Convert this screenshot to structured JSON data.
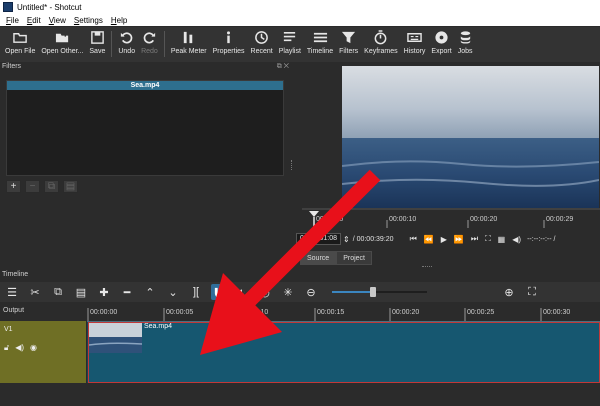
{
  "window": {
    "title": "Untitled* - Shotcut"
  },
  "menu": [
    "File",
    "Edit",
    "View",
    "Settings",
    "Help"
  ],
  "toolbar": [
    {
      "label": "Open File",
      "icon": "open-file-icon",
      "enabled": true
    },
    {
      "label": "Open Other...",
      "icon": "open-other-icon",
      "enabled": true
    },
    {
      "label": "Save",
      "icon": "save-icon",
      "enabled": true
    },
    {
      "label": "Undo",
      "icon": "undo-icon",
      "enabled": true
    },
    {
      "label": "Redo",
      "icon": "redo-icon",
      "enabled": false
    },
    {
      "label": "Peak Meter",
      "icon": "peak-meter-icon",
      "enabled": true
    },
    {
      "label": "Properties",
      "icon": "properties-icon",
      "enabled": true
    },
    {
      "label": "Recent",
      "icon": "recent-icon",
      "enabled": true
    },
    {
      "label": "Playlist",
      "icon": "playlist-icon",
      "enabled": true
    },
    {
      "label": "Timeline",
      "icon": "timeline-icon",
      "enabled": true
    },
    {
      "label": "Filters",
      "icon": "filters-icon",
      "enabled": true
    },
    {
      "label": "Keyframes",
      "icon": "keyframes-icon",
      "enabled": true
    },
    {
      "label": "History",
      "icon": "history-icon",
      "enabled": true
    },
    {
      "label": "Export",
      "icon": "export-icon",
      "enabled": true
    },
    {
      "label": "Jobs",
      "icon": "jobs-icon",
      "enabled": true
    }
  ],
  "filters": {
    "header": "Filters",
    "selected_clip": "Sea.mp4"
  },
  "player": {
    "ruler_ticks": [
      "00:00:00",
      "00:00:10",
      "00:00:20",
      "00:00:29"
    ],
    "current_time": "00:00:01:08",
    "duration": "/ 00:00:39:20",
    "in_out": "--:--:--:-- /",
    "tabs": [
      "Source",
      "Project"
    ]
  },
  "timeline": {
    "header": "Timeline",
    "output_label": "Output",
    "ruler_ticks": [
      "00:00:00",
      "00:00:05",
      "00:00:10",
      "00:00:15",
      "00:00:20",
      "00:00:25",
      "00:00:30"
    ],
    "track_name": "V1",
    "clip_label": "Sea.mp4"
  },
  "colors": {
    "accent": "#2f6e9a",
    "clip": "#165770",
    "track_head": "#6f6f25",
    "arrow": "#e8101a",
    "playhead": "#c23838"
  }
}
